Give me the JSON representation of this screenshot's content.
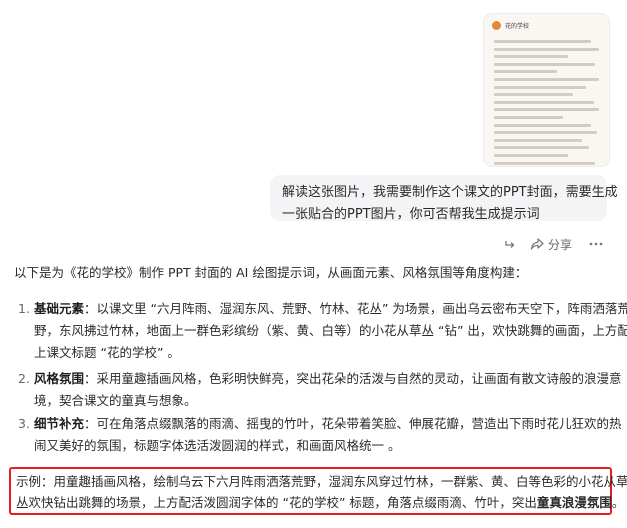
{
  "thumbnail": {
    "title": "花的学校"
  },
  "user_message": {
    "line1": "解读这张图片，我需要制作这个课文的PPT封面，需要生成",
    "line2": "一张贴合的PPT图片，你可否帮我生成提示词"
  },
  "actions": {
    "share_label": "分享",
    "icons": [
      "forward-icon",
      "share-icon",
      "more-icon"
    ]
  },
  "answer": {
    "intro": "以下是为《花的学校》制作 PPT 封面的 AI 绘图提示词，从画面元素、风格氛围等角度构建：",
    "items": [
      {
        "num": "1.",
        "label": "基础元素",
        "line1": "：以课文里 “六月阵雨、湿润东风、荒野、竹林、花丛” 为场景，画出乌云密布天空下，阵雨洒落荒",
        "line2": "野，东风拂过竹林，地面上一群色彩缤纷（紫、黄、白等）的小花从草丛 “钻” 出，欢快跳舞的画面，上方配",
        "line3": "上课文标题 “花的学校” 。"
      },
      {
        "num": "2.",
        "label": "风格氛围",
        "line1": "：采用童趣插画风格，色彩明快鲜亮，突出花朵的活泼与自然的灵动，让画面有散文诗般的浪漫意",
        "line2": "境，契合课文的童真与想象。"
      },
      {
        "num": "3.",
        "label": "细节补充",
        "line1": "：可在角落点缀飘落的雨滴、摇曳的竹叶，花朵带着笑脸、伸展花瓣，营造出下雨时花儿狂欢的热",
        "line2": "闹又美好的氛围，标题字体选活泼圆润的样式，和画面风格统一 。"
      }
    ],
    "example": {
      "line1": "示例：用童趣插画风格，绘制乌云下六月阵雨洒落荒野，湿润东风穿过竹林，一群紫、黄、白等色彩的小花从草",
      "line2_a": "丛欢快钻出跳舞的场景，上方配活泼圆润字体的 “花的学校” 标题，角落点缀雨滴、竹叶，突出",
      "line2_b": "童真浪漫氛围",
      "line2_c": "。"
    }
  },
  "colors": {
    "highlight_border": "#e81c1c",
    "bubble_bg": "#f4f4f6"
  }
}
